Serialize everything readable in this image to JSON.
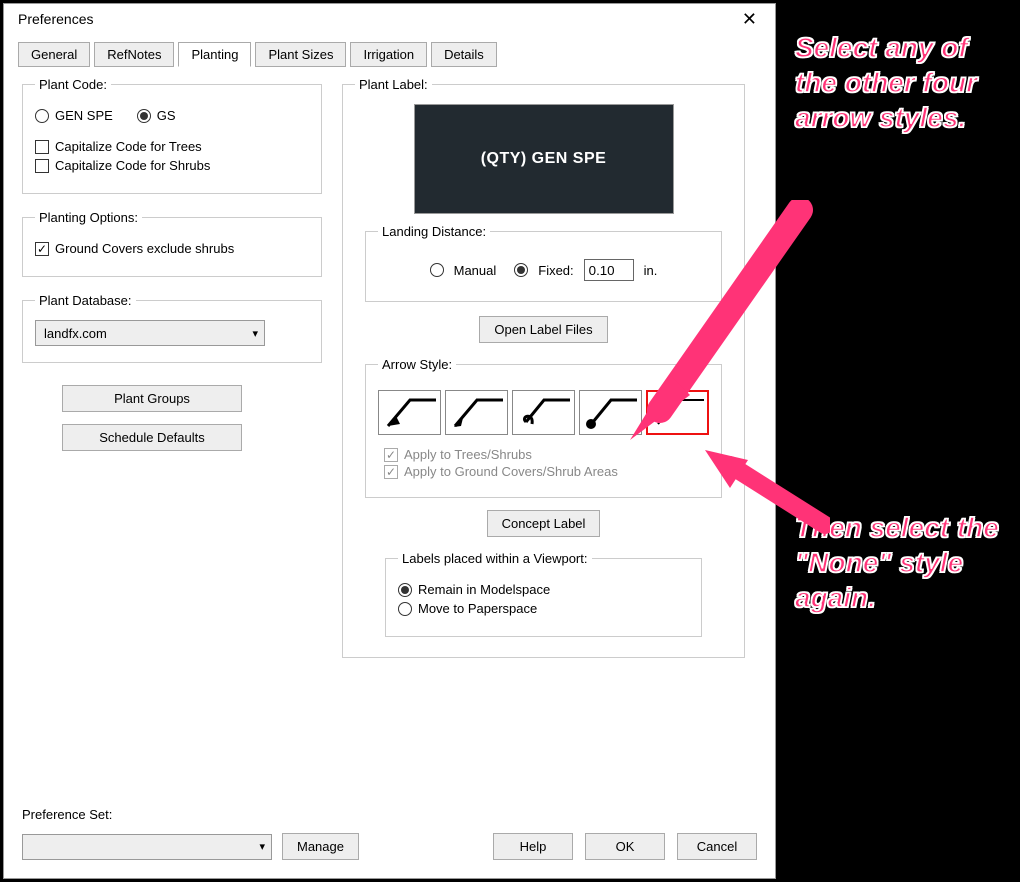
{
  "window": {
    "title": "Preferences"
  },
  "tabs": {
    "items": [
      "General",
      "RefNotes",
      "Planting",
      "Plant Sizes",
      "Irrigation",
      "Details"
    ],
    "active_index": 2
  },
  "plant_code": {
    "legend": "Plant Code:",
    "radios": {
      "gen_spe": "GEN SPE",
      "gs": "GS",
      "selected": "gs"
    },
    "checks": {
      "cap_trees": {
        "label": "Capitalize Code for Trees",
        "checked": false
      },
      "cap_shrubs": {
        "label": "Capitalize Code for Shrubs",
        "checked": false
      }
    }
  },
  "planting_options": {
    "legend": "Planting Options:",
    "gc_exclude": {
      "label": "Ground Covers exclude shrubs",
      "checked": true
    }
  },
  "plant_database": {
    "legend": "Plant Database:",
    "value": "landfx.com"
  },
  "left_buttons": {
    "plant_groups": "Plant Groups",
    "schedule_defaults": "Schedule Defaults"
  },
  "plant_label": {
    "legend": "Plant Label:",
    "preview_text": "(QTY) GEN SPE",
    "landing": {
      "legend": "Landing Distance:",
      "manual": "Manual",
      "fixed": "Fixed:",
      "selected": "fixed",
      "fixed_value": "0.10",
      "unit": "in."
    },
    "open_label_files": "Open Label Files",
    "arrow_style": {
      "legend": "Arrow Style:",
      "selected_index": 4,
      "apply_trees": {
        "label": "Apply to Trees/Shrubs",
        "checked": true,
        "disabled": true
      },
      "apply_gc": {
        "label": "Apply to Ground Covers/Shrub Areas",
        "checked": true,
        "disabled": true
      }
    },
    "concept_label": "Concept Label",
    "viewport": {
      "legend": "Labels placed within a Viewport:",
      "remain": "Remain in Modelspace",
      "move": "Move to Paperspace",
      "selected": "remain"
    }
  },
  "pref_set": {
    "label": "Preference Set:",
    "value": "",
    "manage": "Manage"
  },
  "dlg_buttons": {
    "help": "Help",
    "ok": "OK",
    "cancel": "Cancel"
  },
  "annotations": {
    "top": "Select any of the other four arrow styles.",
    "bottom": "Then select the \"None\" style again."
  },
  "colors": {
    "accent_annot": "#ff3377",
    "selected_border": "#e11"
  }
}
